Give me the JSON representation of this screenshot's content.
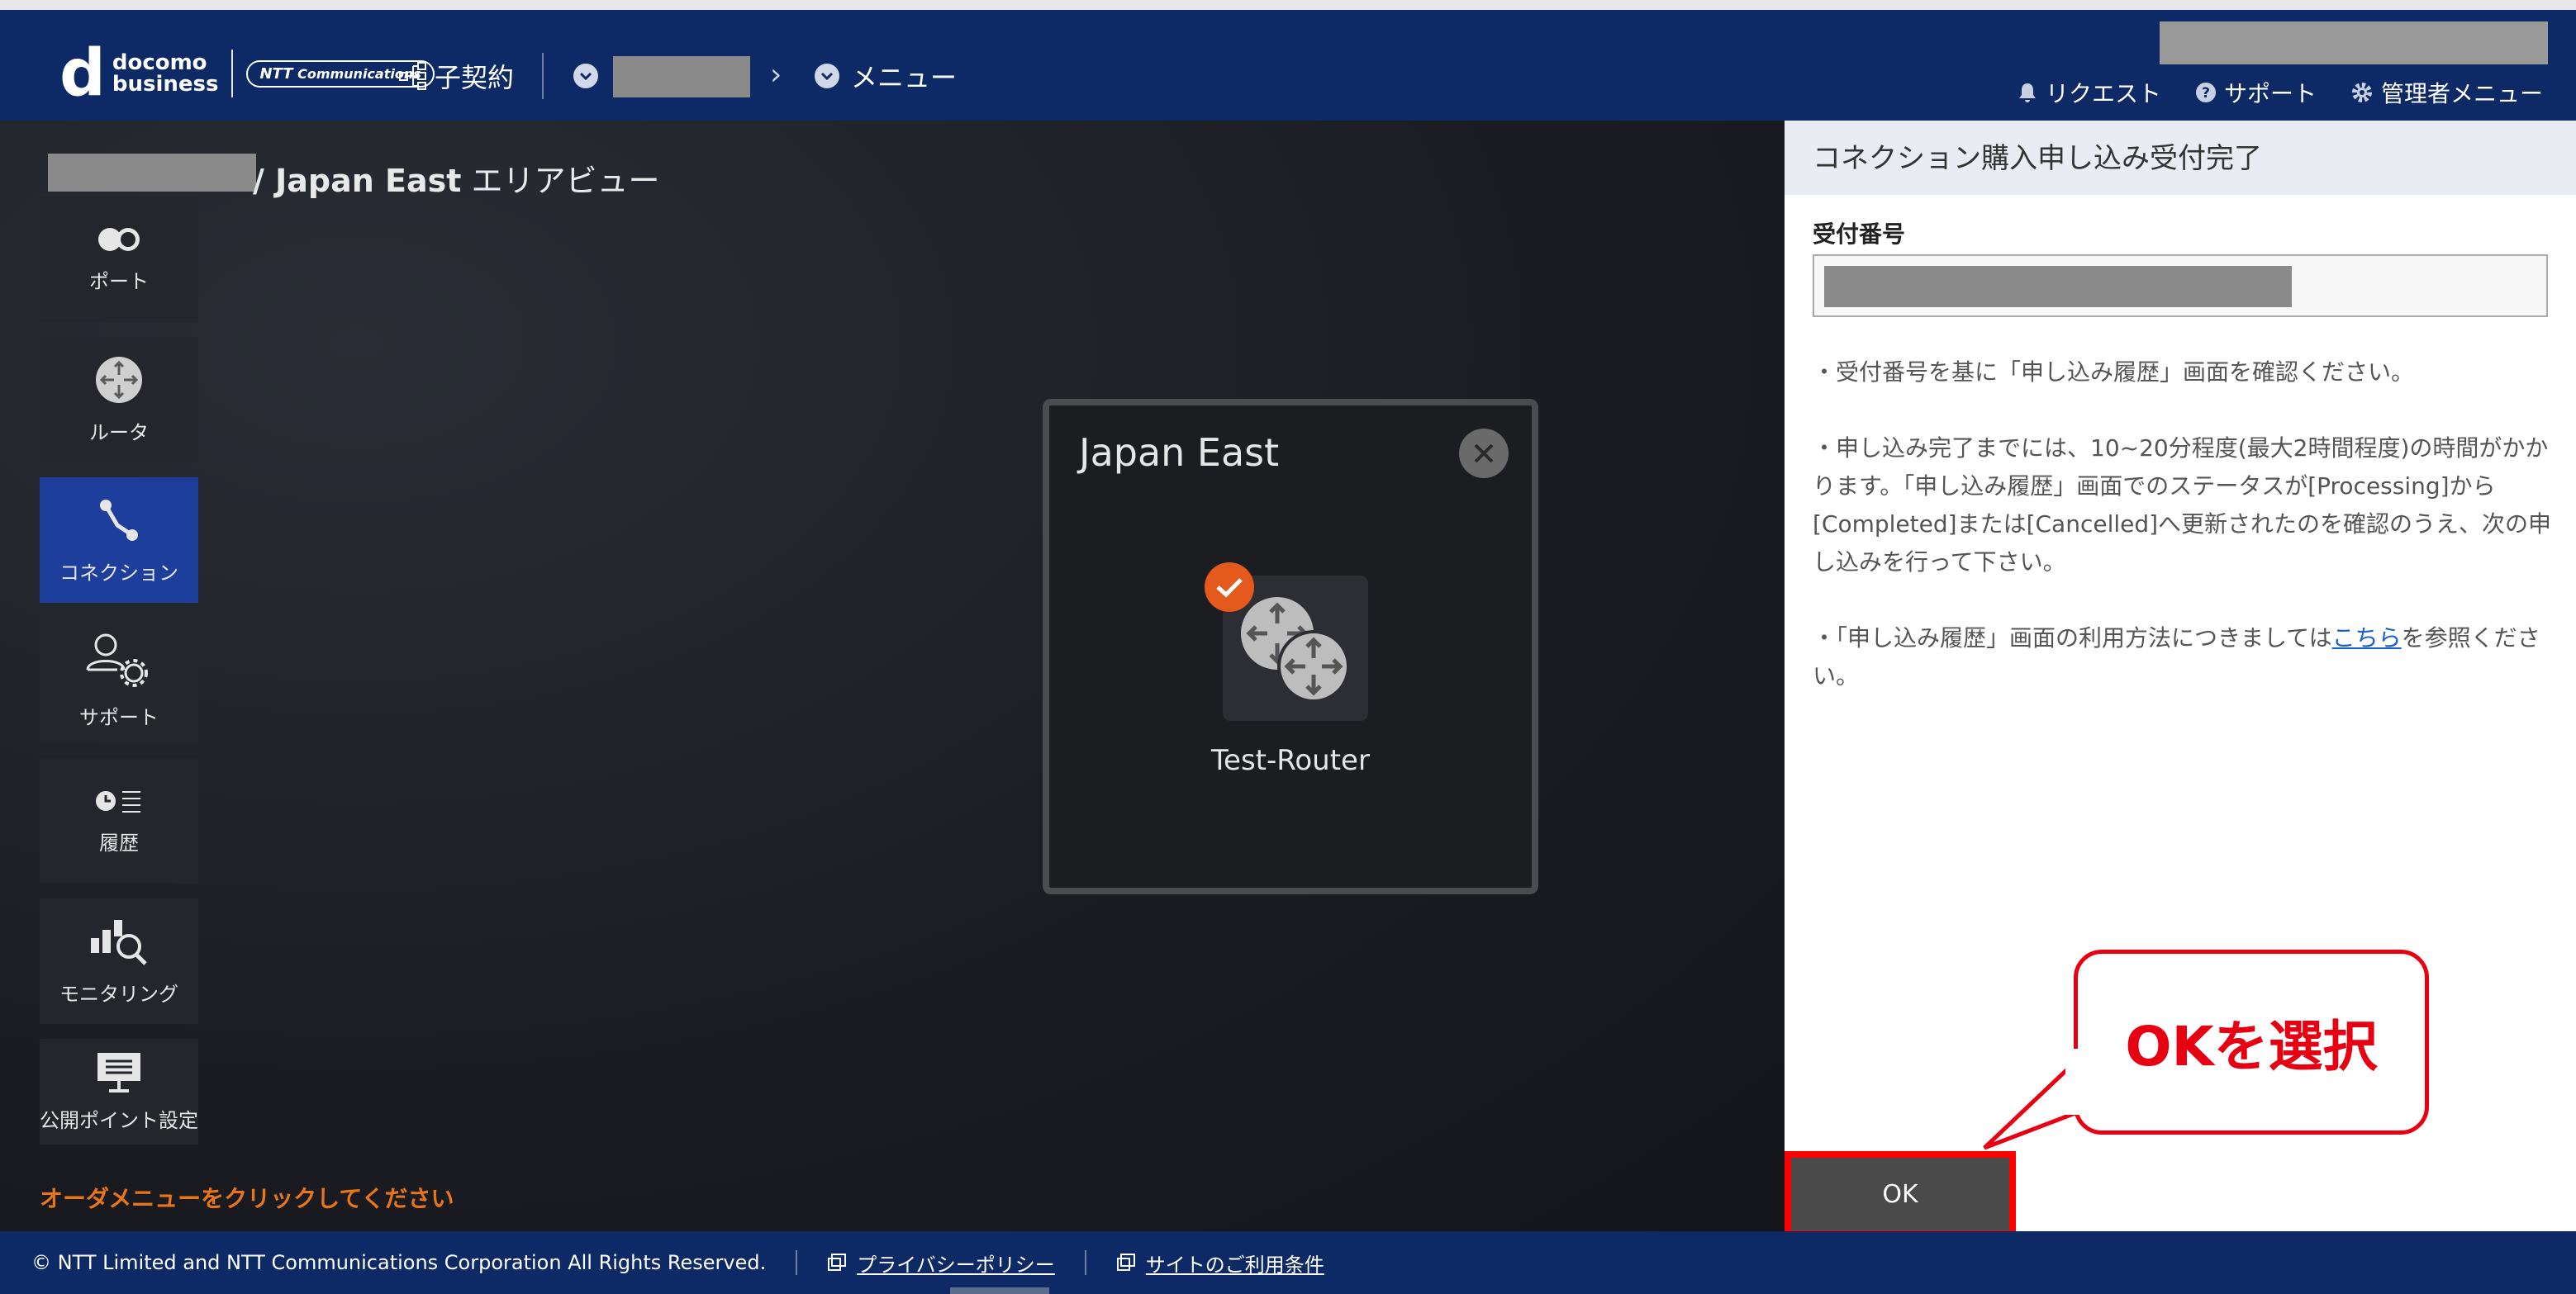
{
  "header": {
    "logo_docomo": "docomo",
    "logo_business": "business",
    "logo_ntt_prefix": "NTT",
    "logo_ntt_suffix": "Communications",
    "contract_label": "子契約",
    "breadcrumb_arrow": "›",
    "menu_label": "メニュー",
    "links": {
      "request": "リクエスト",
      "support": "サポート",
      "admin": "管理者メニュー"
    }
  },
  "main": {
    "area_title_prefix": "/ Japan East",
    "area_title_suffix": " エリアビュー",
    "order_hint": "オーダメニューをクリックしてください"
  },
  "sidebar": {
    "items": [
      {
        "label": "ポート",
        "icon": "port-icon"
      },
      {
        "label": "ルータ",
        "icon": "router-icon"
      },
      {
        "label": "コネクション",
        "icon": "connection-icon"
      },
      {
        "label": "サポート",
        "icon": "support-icon"
      },
      {
        "label": "履歴",
        "icon": "history-icon"
      },
      {
        "label": "モニタリング",
        "icon": "monitoring-icon"
      },
      {
        "label": "公開ポイント設定",
        "icon": "public-point-icon"
      }
    ],
    "active_index": 2
  },
  "popup": {
    "title": "Japan East",
    "router_name": "Test-Router"
  },
  "panel": {
    "title": "コネクション購入申し込み受付完了",
    "receipt_label": "受付番号",
    "para1": "・受付番号を基に「申し込み履歴」画面を確認ください。",
    "para2": "・申し込み完了までには、10~20分程度(最大2時間程度)の時間がかかります。「申し込み履歴」画面でのステータスが[Processing]から[Completed]または[Cancelled]へ更新されたのを確認のうえ、次の申し込みを行って下さい。",
    "para3_before": "・「申し込み履歴」画面の利用方法につきましては",
    "para3_link": "こちら",
    "para3_after": "を参照ください。"
  },
  "ok_button": "OK",
  "callout": "OKを選択",
  "footer": {
    "copyright": "© NTT Limited and NTT Communications Corporation All Rights Reserved.",
    "privacy": "プライバシーポリシー",
    "terms": "サイトのご利用条件"
  },
  "colors": {
    "header_bg": "#0d2a66",
    "active_item": "#1e3e9c",
    "callout_red": "#e60012",
    "hint_orange": "#e8751a"
  }
}
